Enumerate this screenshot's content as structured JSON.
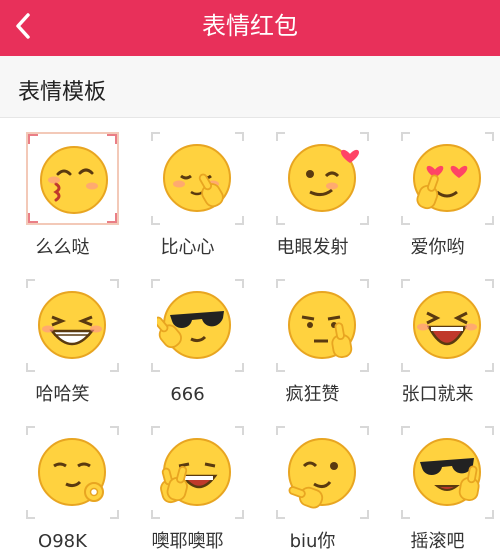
{
  "header": {
    "title": "表情红包",
    "back_icon": "chevron-left-icon",
    "color": "#e8305a"
  },
  "section": {
    "title": "表情模板"
  },
  "templates": [
    {
      "label": "么么哒",
      "icon": "kiss-face-icon",
      "selected": true
    },
    {
      "label": "比心心",
      "icon": "finger-heart-face-icon",
      "selected": false
    },
    {
      "label": "电眼发射",
      "icon": "wink-heart-face-icon",
      "selected": false
    },
    {
      "label": "爱你哟",
      "icon": "heart-eyes-face-icon",
      "selected": false
    },
    {
      "label": "哈哈笑",
      "icon": "laughing-face-icon",
      "selected": false
    },
    {
      "label": "666",
      "icon": "sunglasses-face-icon",
      "selected": false
    },
    {
      "label": "疯狂赞",
      "icon": "thinking-face-icon",
      "selected": false
    },
    {
      "label": "张口就来",
      "icon": "open-mouth-laugh-icon",
      "selected": false
    },
    {
      "label": "O98K",
      "icon": "ok-hand-face-icon",
      "selected": false
    },
    {
      "label": "噢耶噢耶",
      "icon": "victory-face-icon",
      "selected": false
    },
    {
      "label": "biu你",
      "icon": "finger-gun-face-icon",
      "selected": false
    },
    {
      "label": "摇滚吧",
      "icon": "rock-sunglasses-face-icon",
      "selected": false
    }
  ]
}
